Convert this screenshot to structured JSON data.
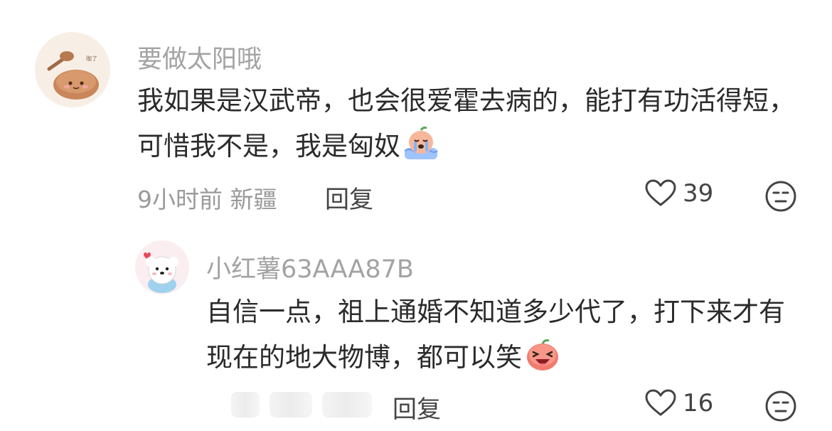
{
  "comment": {
    "username": "要做太阳哦",
    "text": "我如果是汉武帝，也会很爱霍去病的，能打有功活得短，可惜我不是，我是匈奴",
    "emoji_icon": "crying-peach-emoji",
    "time": "9小时前",
    "location": "新疆",
    "reply_label": "回复",
    "like_count": "39"
  },
  "reply": {
    "username": "小红薯63AAA87B",
    "text": "自信一点，祖上通婚不知道多少代了，打下来才有现在的地大物博，都可以笑",
    "emoji_icon": "laughing-peach-emoji",
    "reply_label": "回复",
    "like_count": "16"
  },
  "icons": {
    "like": "heart-outline-icon",
    "dislike": "unamused-face-icon"
  },
  "colors": {
    "username": "#a3a3a3",
    "text": "#2b2b2b",
    "meta": "#9a9a9a",
    "action": "#444444"
  }
}
